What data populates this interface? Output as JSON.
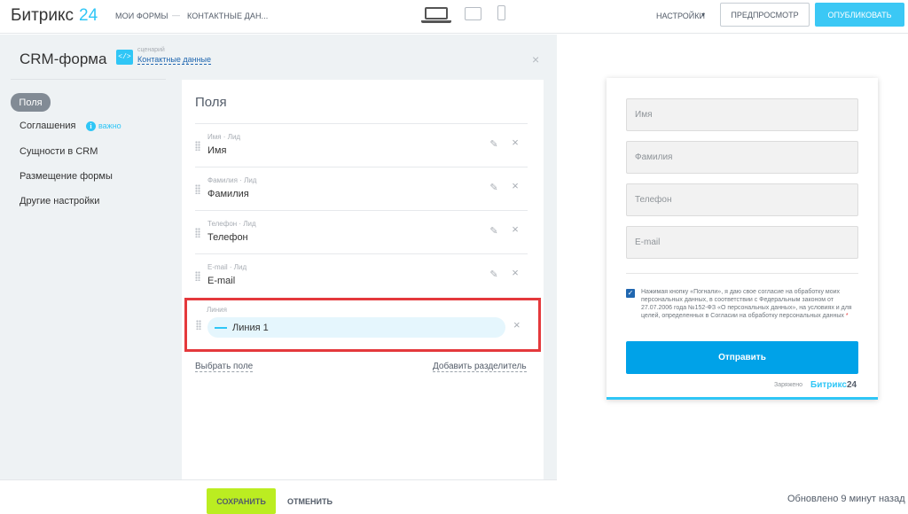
{
  "header": {
    "logo_text": "Битрикс",
    "logo_number": "24",
    "breadcrumb": [
      "МОИ ФОРМЫ",
      "КОНТАКТНЫЕ ДАН..."
    ],
    "breadcrumb_separator": "—",
    "settings_label": "НАСТРОЙКИ",
    "preview_label": "ПРЕДПРОСМОТР",
    "publish_label": "ОПУБЛИКОВАТЬ"
  },
  "panel": {
    "title": "CRM-форма",
    "scenario_icon": "</>",
    "scenario_caption": "сценарий",
    "scenario_link": "Контактные данные",
    "close_icon": "×"
  },
  "menu": {
    "active": "Поля",
    "items": [
      "Соглашения",
      "Сущности в CRM",
      "Размещение формы",
      "Другие настройки"
    ],
    "info_badge": "важно"
  },
  "fields_card": {
    "title": "Поля",
    "fields": [
      {
        "caption": "Имя · Лид",
        "name": "Имя"
      },
      {
        "caption": "Фамилия · Лид",
        "name": "Фамилия"
      },
      {
        "caption": "Телефон · Лид",
        "name": "Телефон"
      },
      {
        "caption": "E-mail · Лид",
        "name": "E-mail"
      }
    ],
    "line_field": {
      "caption": "Линия",
      "name": "Линия 1"
    },
    "select_field_link": "Выбрать поле",
    "add_separator_link": "Добавить разделитель"
  },
  "footer": {
    "save_label": "СОХРАНИТЬ",
    "cancel_label": "ОТМЕНИТЬ",
    "updated_status": "Обновлено 9 минут назад"
  },
  "preview": {
    "inputs": [
      "Имя",
      "Фамилия",
      "Телефон",
      "E-mail"
    ],
    "consent_text": "Нажимая кнопку «Погнали», я даю свое согласие на обработку моих персональных данных, в соответствии с Федеральным законом от 27.07.2006 года №152-ФЗ «О персональных данных», на условиях и для целей, определенных в Согласии на обработку персональных данных",
    "consent_required_mark": "*",
    "submit_label": "Отправить",
    "powered_by": "Заряжено",
    "powered_logo": "Битрикс",
    "powered_logo_number": "24"
  },
  "colors": {
    "accent": "#2fc6f6",
    "save_button": "#bbed21",
    "highlight_border": "#e4393c",
    "submit_button": "#00a2e8"
  }
}
